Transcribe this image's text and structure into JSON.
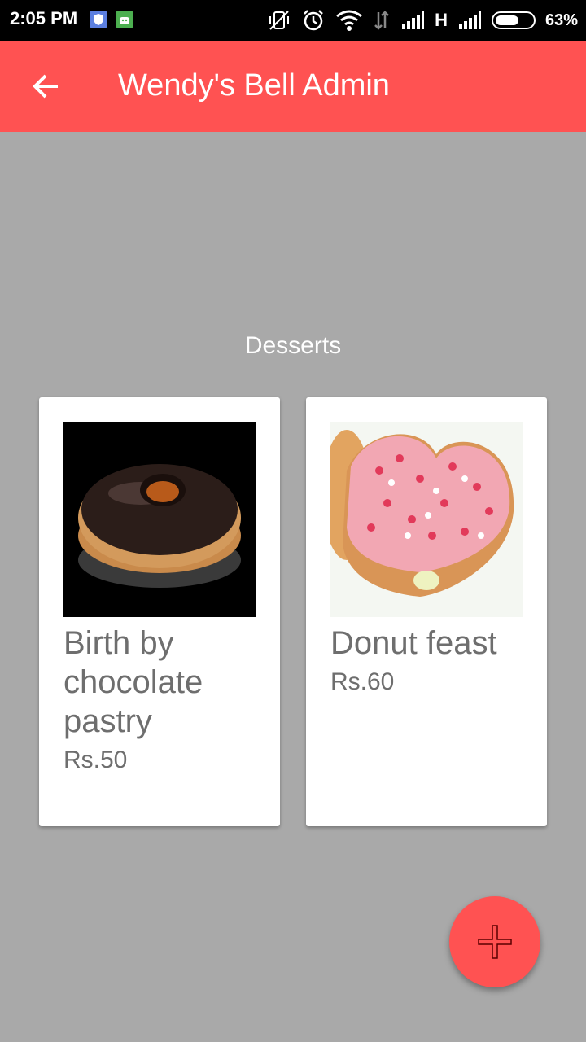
{
  "status_bar": {
    "time": "2:05 PM",
    "network": "H",
    "battery_level": 0.63,
    "battery_text": "63%",
    "icons": [
      "shield-app-icon",
      "android-app-icon",
      "vibrate-off-icon",
      "alarm-icon",
      "wifi-icon",
      "data-arrows-icon",
      "signal-icon",
      "signal-icon",
      "battery-icon"
    ]
  },
  "app_bar": {
    "title": "Wendy's Bell Admin",
    "back_icon": "arrow-back-icon",
    "background": "#ff5252"
  },
  "section": {
    "title": "Desserts"
  },
  "items": [
    {
      "name": "Birth by chocolate pastry",
      "price": "Rs.50",
      "image": "chocolate-donut"
    },
    {
      "name": "Donut feast",
      "price": "Rs.60",
      "image": "heart-sprinkle-donut"
    }
  ],
  "fab": {
    "icon": "plus-icon"
  },
  "colors": {
    "accent": "#ff5252",
    "background": "#a9a9a9",
    "card": "#ffffff",
    "text_secondary": "#6e6e6e"
  }
}
